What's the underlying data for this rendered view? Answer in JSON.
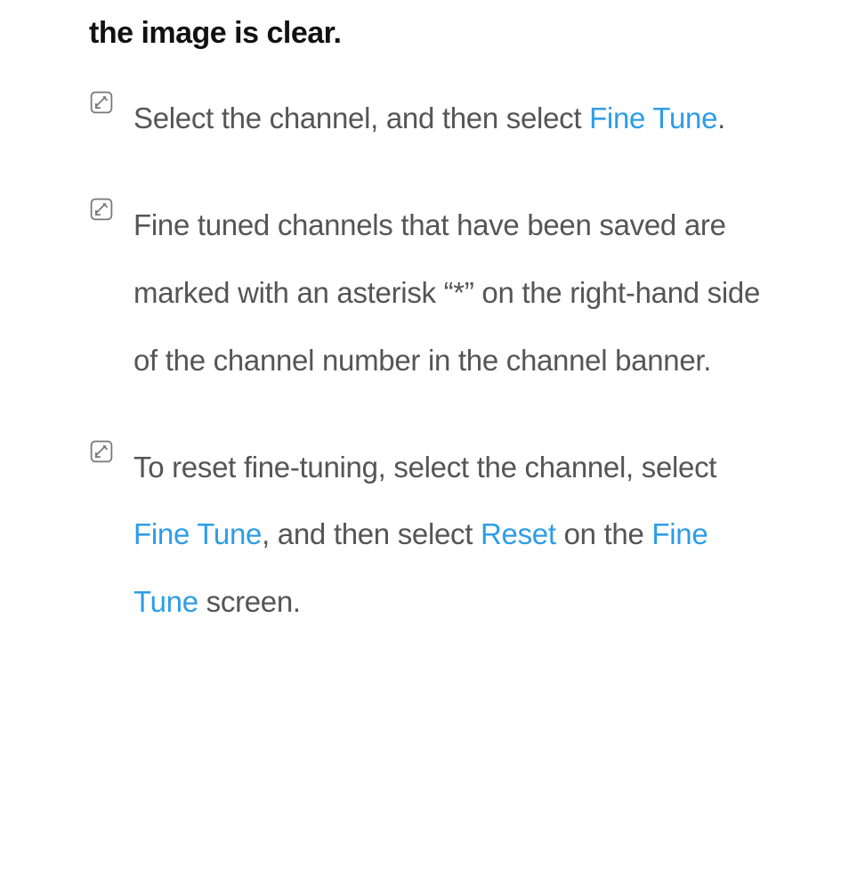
{
  "heading": "the image is clear.",
  "notes": [
    {
      "parts": [
        {
          "text": "Select the channel, and then select "
        },
        {
          "text": "Fine Tune",
          "term": true
        },
        {
          "text": "."
        }
      ]
    },
    {
      "parts": [
        {
          "text": "Fine tuned channels that have been saved are marked with an asterisk “*” on the right-hand side of the channel number in the channel banner."
        }
      ]
    },
    {
      "parts": [
        {
          "text": "To reset fine-tuning, select the channel, select "
        },
        {
          "text": "Fine Tune",
          "term": true
        },
        {
          "text": ", and then select "
        },
        {
          "text": "Reset",
          "term": true
        },
        {
          "text": " on the "
        },
        {
          "text": "Fine Tune",
          "term": true
        },
        {
          "text": " screen."
        }
      ]
    }
  ]
}
